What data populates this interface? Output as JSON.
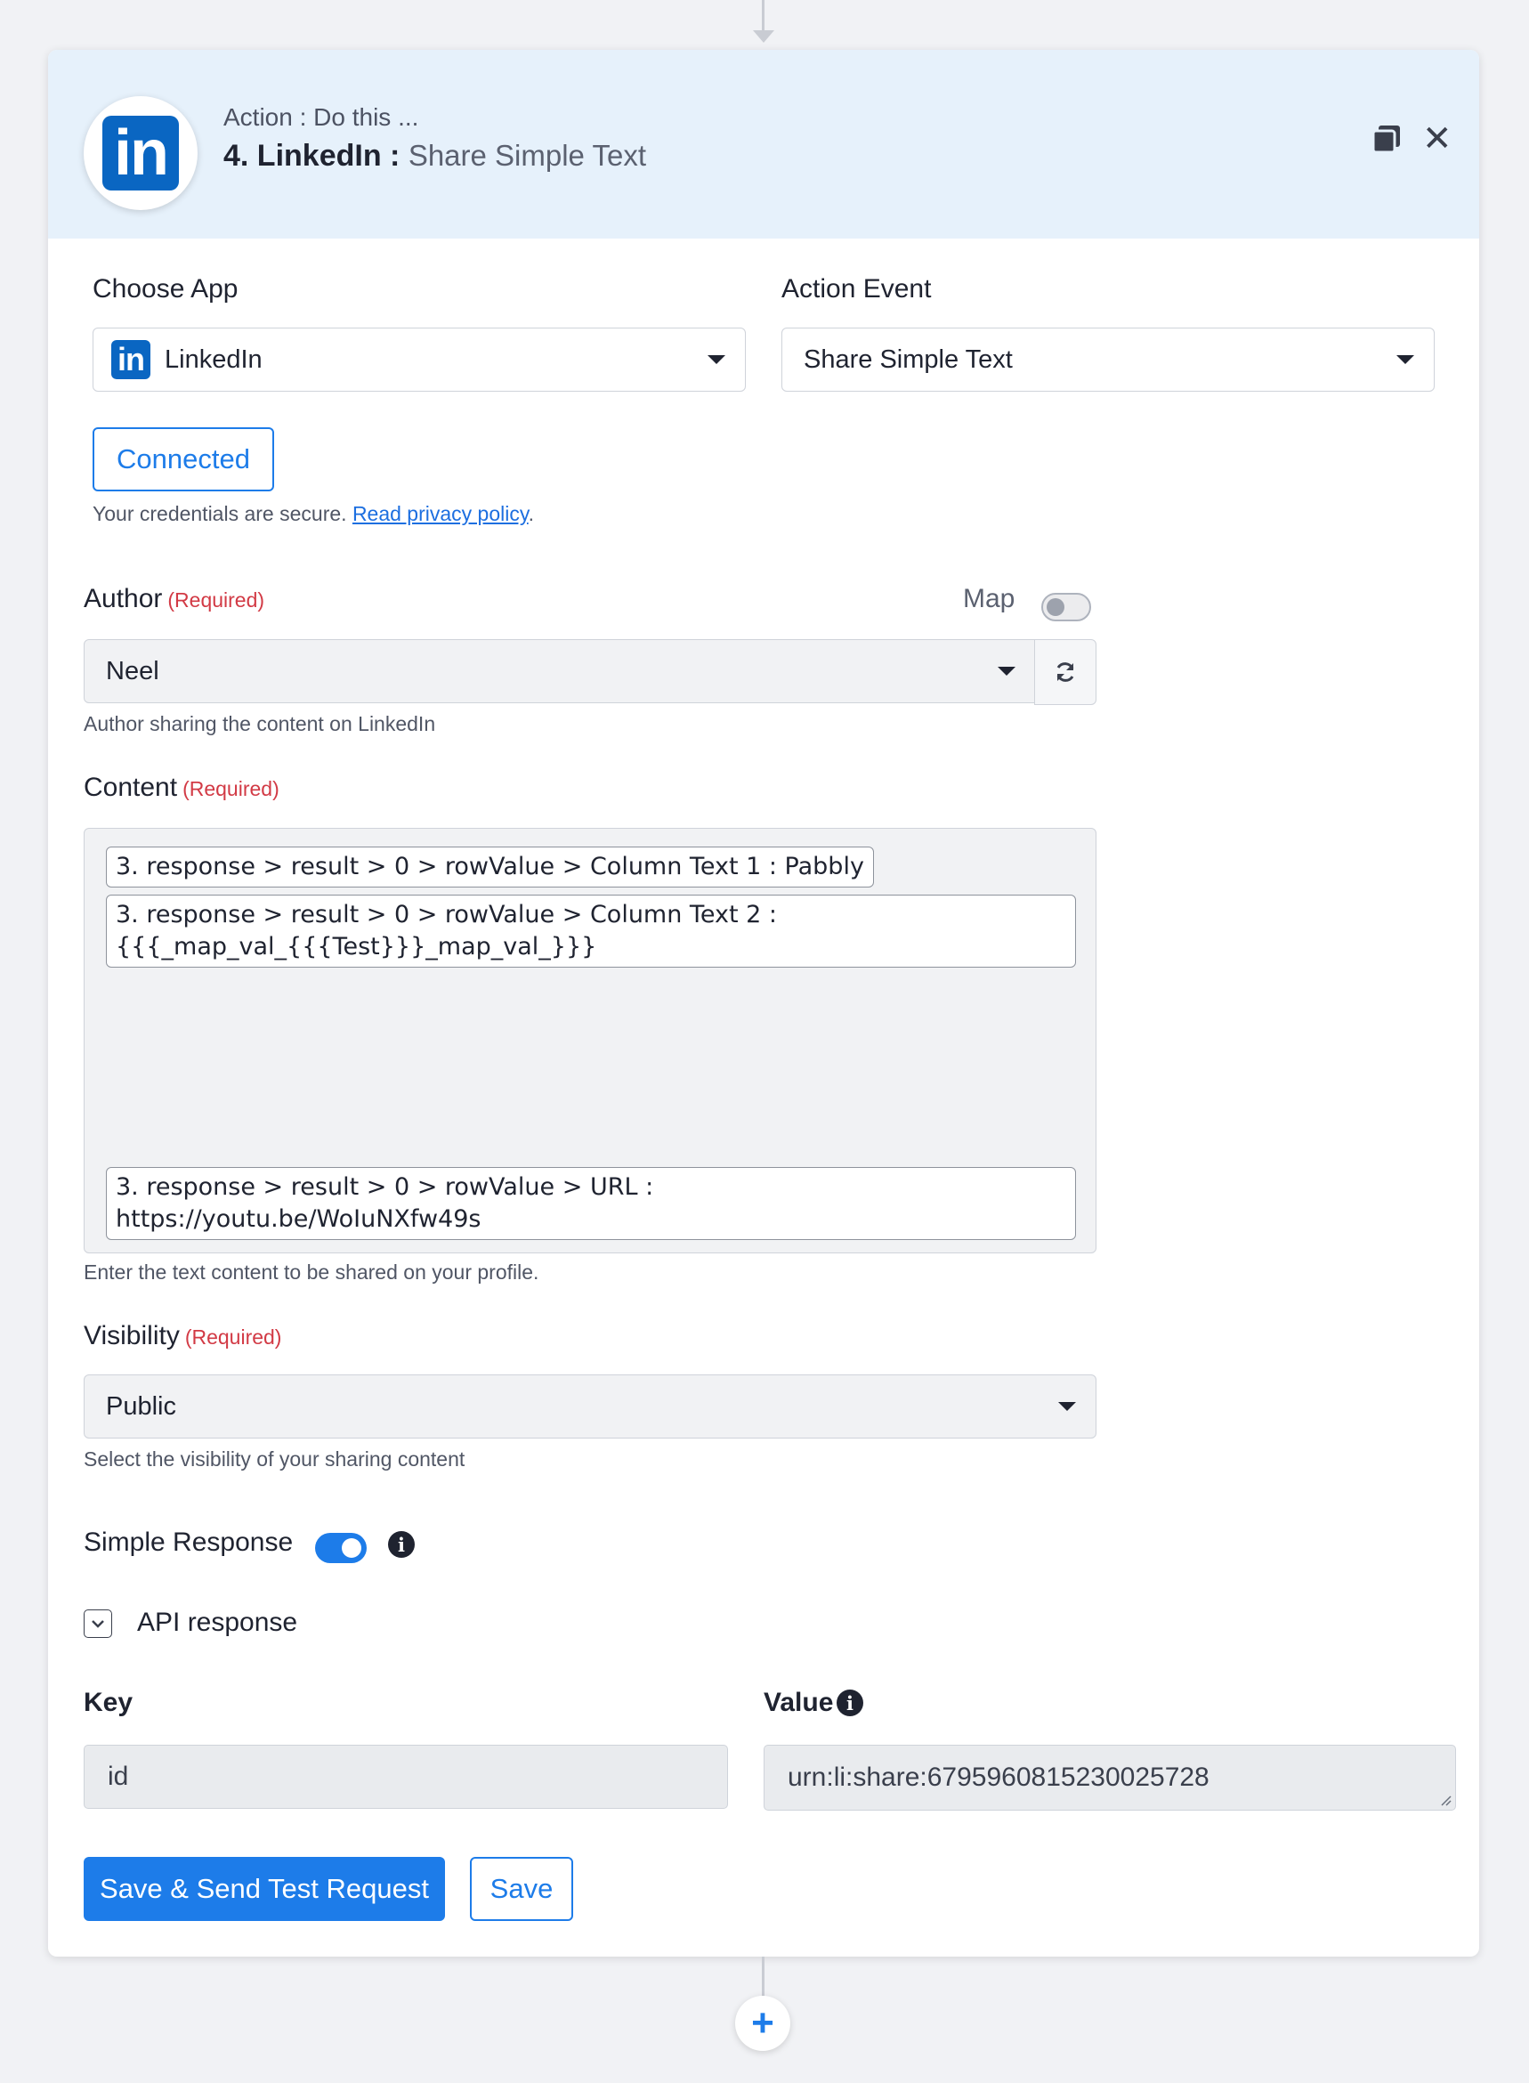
{
  "header": {
    "subtitle": "Action : Do this ...",
    "step_title": "4. LinkedIn :",
    "event_title": "Share Simple Text",
    "logo_text": "in"
  },
  "choose_app": {
    "label": "Choose App",
    "value": "LinkedIn"
  },
  "action_event": {
    "label": "Action Event",
    "value": "Share Simple Text"
  },
  "connection": {
    "button_label": "Connected",
    "security_text": "Your credentials are secure.",
    "privacy_link": "Read privacy policy",
    "period": "."
  },
  "author": {
    "label": "Author",
    "required": "(Required)",
    "map_label": "Map",
    "value": "Neel",
    "helper": "Author sharing the content on LinkedIn"
  },
  "content": {
    "label": "Content",
    "required": "(Required)",
    "chips": [
      "3. response > result > 0 > rowValue > Column Text 1 : Pabbly",
      "3. response > result > 0 > rowValue > Column Text 2 :\n{{{_map_val_{{{Test}}}_map_val_}}}",
      "3. response > result > 0 > rowValue > URL :\nhttps://youtu.be/WoIuNXfw49s"
    ],
    "helper": "Enter the text content to be shared on your profile."
  },
  "visibility": {
    "label": "Visibility",
    "required": "(Required)",
    "value": "Public",
    "helper": "Select the visibility of your sharing content"
  },
  "simple_response": {
    "label": "Simple Response",
    "enabled": true
  },
  "api_response": {
    "label": "API response",
    "key_header": "Key",
    "value_header": "Value",
    "key": "id",
    "value": "urn:li:share:6795960815230025728"
  },
  "buttons": {
    "save_send": "Save & Send Test Request",
    "save": "Save"
  },
  "add_step_symbol": "+",
  "colors": {
    "accent": "#1d7ce9",
    "required": "#d23a45",
    "header_bg": "#e6f1fb",
    "linkedin": "#0a66c2"
  }
}
